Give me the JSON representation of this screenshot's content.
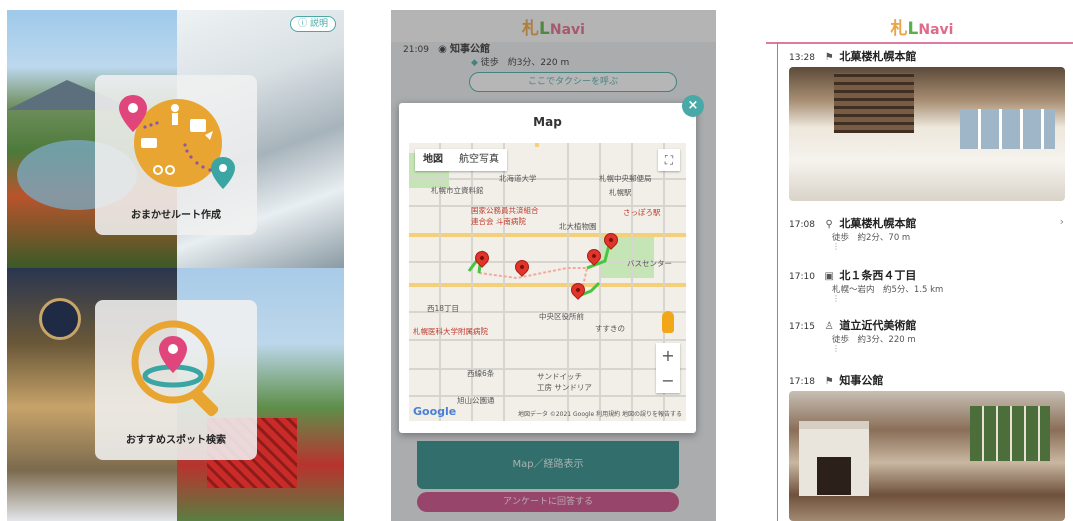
{
  "screen1": {
    "help_label": "ⓘ 説明",
    "route_card_label": "おまかせルート作成",
    "spot_card_label": "おすすめスポット検索"
  },
  "screen2": {
    "logo": {
      "part1": "札",
      "part2": "L",
      "part3": "Navi"
    },
    "top_entry": {
      "time": "21:09",
      "name": "知事公館",
      "mode": "徒歩",
      "detail": "約3分、220 m"
    },
    "taxi_button": "ここでタクシーを呼ぶ",
    "modal_title": "Map",
    "map_tabs": [
      "地図",
      "航空写真"
    ],
    "map_labels": {
      "l1": "札幌市立資料館",
      "l2": "国家公務員共済組合\n連合会 斗南病院",
      "l3": "さっぽろ駅",
      "l4": "北大植物園",
      "l5": "札幌医科大学附属病院",
      "l6": "西18丁目",
      "l7": "中央区役所前",
      "l8": "すすきの",
      "l9": "サンドイッチ\n工房 サンドリア",
      "l10": "西線6条",
      "l11": "札幌中央郵便局",
      "l12": "北海道大学",
      "l13": "札幌駅",
      "l14": "バスセンター",
      "l15": "旭山公園通"
    },
    "map_google": "Google",
    "map_attribution": "地図データ ©2021 Google  利用規約  地図の誤りを報告する",
    "map_route_button": "Map／経路表示",
    "survey_button": "アンケートに回答する"
  },
  "screen3": {
    "logo": {
      "part1": "札",
      "part2": "L",
      "part3": "Navi"
    },
    "entries": [
      {
        "time": "13:28",
        "icon": "flag-icon",
        "name": "北菓楼札幌本館",
        "sub": "",
        "chevron": false
      },
      {
        "time": "17:08",
        "icon": "pin-icon",
        "name": "北菓楼札幌本館",
        "sub": "徒歩　約2分、70 m",
        "chevron": true
      },
      {
        "time": "17:10",
        "icon": "bus-icon",
        "name": "北１条西４丁目",
        "sub": "札幌〜岩内　約5分、1.5 km",
        "chevron": false
      },
      {
        "time": "17:15",
        "icon": "walk-icon",
        "name": "道立近代美術館",
        "sub": "徒歩　約3分、220 m",
        "chevron": false
      },
      {
        "time": "17:18",
        "icon": "flag-icon",
        "name": "知事公館",
        "sub": "",
        "chevron": false
      }
    ]
  },
  "colors": {
    "teal": "#48a9a6",
    "pink": "#c94b84",
    "orange": "#e8a54a"
  }
}
